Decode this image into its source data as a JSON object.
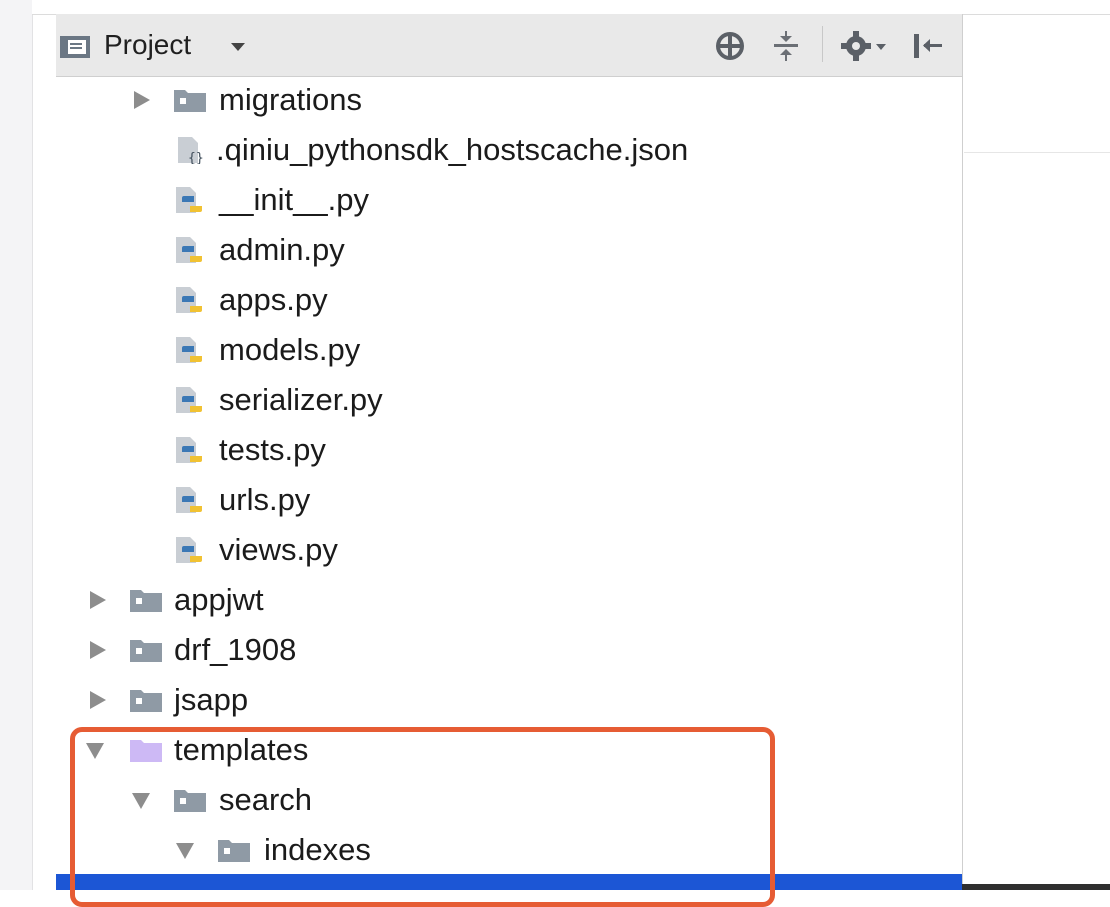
{
  "toolbar": {
    "title": "Project",
    "icons": [
      "project-view-icon",
      "dropdown-caret-icon",
      "locate-target-icon",
      "collapse-all-icon",
      "settings-gear-icon",
      "hide-panel-icon"
    ]
  },
  "colors": {
    "folder_plain": "#8f9aa5",
    "folder_templates": "#cdb9f5",
    "selection": "#1c56d5",
    "highlight": "#e65c34",
    "python_blue": "#3b78b5",
    "python_yellow": "#f1c232"
  },
  "tree": [
    {
      "label": "migrations",
      "kind": "folder",
      "expanded": false
    },
    {
      "label": ".qiniu_pythonsdk_hostscache.json",
      "kind": "json"
    },
    {
      "label": "__init__.py",
      "kind": "python"
    },
    {
      "label": "admin.py",
      "kind": "python"
    },
    {
      "label": "apps.py",
      "kind": "python"
    },
    {
      "label": "models.py",
      "kind": "python"
    },
    {
      "label": "serializer.py",
      "kind": "python"
    },
    {
      "label": "tests.py",
      "kind": "python"
    },
    {
      "label": "urls.py",
      "kind": "python"
    },
    {
      "label": "views.py",
      "kind": "python"
    },
    {
      "label": "appjwt",
      "kind": "folder",
      "expanded": false
    },
    {
      "label": "drf_1908",
      "kind": "folder",
      "expanded": false
    },
    {
      "label": "jsapp",
      "kind": "folder",
      "expanded": false
    },
    {
      "label": "templates",
      "kind": "folder-templates",
      "expanded": true
    },
    {
      "label": "search",
      "kind": "folder",
      "expanded": true
    },
    {
      "label": "indexes",
      "kind": "folder",
      "expanded": true
    }
  ]
}
